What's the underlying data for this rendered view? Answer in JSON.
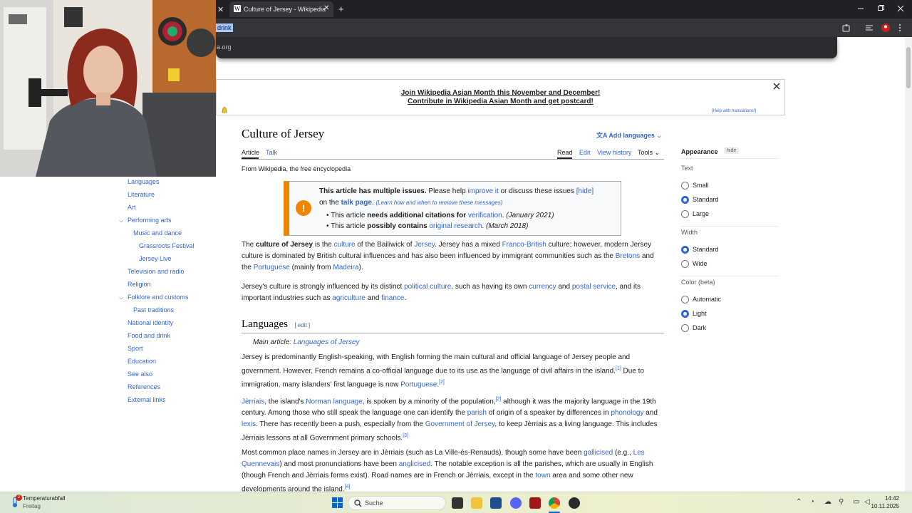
{
  "browser": {
    "tab_title": "Culture of Jersey - Wikipedia",
    "favicon": "W",
    "close_glyph": "✕",
    "new_tab_glyph": "+",
    "selected_text": "drink",
    "omnibox_suggestion": "a.org"
  },
  "banner": {
    "line1": "Join Wikipedia Asian Month this November and December!",
    "line2": "Contribute in Wikipedia Asian Month and get postcard!",
    "help": "[Help with translations!]"
  },
  "article": {
    "title": "Culture of Jersey",
    "add_languages": "Add languages",
    "tabs_left": [
      "Article",
      "Talk"
    ],
    "tabs_right": [
      "Read",
      "Edit",
      "View history",
      "Tools"
    ],
    "tagline": "From Wikipedia, the free encyclopedia"
  },
  "ambox": {
    "heading": "This article has multiple issues.",
    "line1_rest1": " Please help ",
    "improve_link": "improve it",
    "line1_rest2": " or discuss these issues ",
    "hide": "[hide]",
    "on_the": "on the ",
    "talk_page": "talk page",
    "learn": "(Learn how and when to remove these messages)",
    "issue1_a": "This article ",
    "issue1_b": "needs additional citations for",
    "issue1_link": "verification",
    "issue1_date": "(January 2021)",
    "issue2_a": "This article ",
    "issue2_b": "possibly contains",
    "issue2_link": "original research",
    "issue2_date": "(March 2018)"
  },
  "paragraphs": {
    "p1": {
      "t1": "The ",
      "b1": "culture of Jersey",
      "t2": " is the ",
      "l1": "culture",
      "t3": " of the Bailiwick of ",
      "l2": "Jersey",
      "t4": ". Jersey has a mixed ",
      "l3": "Franco-British",
      "t5": " culture; however, modern Jersey",
      "t6": "culture is dominated by British cultural influences and has also been influenced by immigrant communities such as the ",
      "l4": "Bretons",
      "t7": " and",
      "t8": "the ",
      "l5": "Portuguese",
      "t9": " (mainly from ",
      "l6": "Madeira",
      "t10": ")."
    },
    "p2": {
      "t1": "Jersey's culture is strongly influenced by its distinct ",
      "l1": "political culture",
      "t2": ", such as having its own ",
      "l2": "currency",
      "t3": " and ",
      "l3": "postal service",
      "t4": ", and its",
      "t5": "important industries such as ",
      "l4": "agriculture",
      "t6": " and ",
      "l5": "finance",
      "t7": "."
    },
    "h_languages": "Languages",
    "edit": "edit",
    "main_article_label": "Main article: ",
    "main_article_link": "Languages of Jersey",
    "p3": {
      "l1": "Jersey is predominantly English-speaking, with English forming the main cultural and official language of Jersey people and",
      "l2a": "government. However, French remains a co-official language due to its use as the language of civil affairs in the island.",
      "s1": "[1]",
      "l2b": " Due to",
      "l3a": "immigration, many islanders' first language is now ",
      "link": "Portuguese",
      "l3b": ".",
      "s2": "[2]"
    },
    "p4": {
      "link1": "Jèrriais",
      "t1": ", the island's ",
      "link2": "Norman language",
      "t2": ", is spoken by a minority of the population,",
      "s1": "[2]",
      "t3": " although it was the majority language in the 19th",
      "t4": "century. Among those who still speak the language one can identify the ",
      "link3": "parish",
      "t5": " of origin of a speaker by differences in ",
      "link4": "phonology",
      "t6": " and",
      "link5": "lexis",
      "t7": ". There has recently been a push, especially from the ",
      "link6": "Government of Jersey",
      "t8": ", to keep Jèrriais as a living language. This includes",
      "t9": "Jèrriais lessons at all Government primary schools.",
      "s2": "[3]"
    },
    "p5": {
      "t1": "Most common place names in Jersey are in Jèrriais (such as La Ville-ès-Renauds), though some have been ",
      "link1": "gallicised",
      "t2": " (e.g., ",
      "link2": "Les",
      "link2b": "Quennevais",
      "t3": ") and most pronunciations have been ",
      "link3": "anglicised",
      "t4": ". The notable exception is all the parishes, which are usually in English",
      "t5": "(though French and Jèrriais forms exist). Road names are in French or Jèrriais, except in the ",
      "link4": "town",
      "t6": " area and some other new",
      "t7": "developments around the island.",
      "s1": "[4]"
    }
  },
  "toc": [
    {
      "label": "Languages",
      "indent": 0,
      "caret": false
    },
    {
      "label": "Literature",
      "indent": 0,
      "caret": false
    },
    {
      "label": "Art",
      "indent": 0,
      "caret": false
    },
    {
      "label": "Performing arts",
      "indent": 0,
      "caret": true
    },
    {
      "label": "Music and dance",
      "indent": 1,
      "caret": false
    },
    {
      "label": "Grassroots Festival",
      "indent": 2,
      "caret": false
    },
    {
      "label": "Jersey Live",
      "indent": 2,
      "caret": false
    },
    {
      "label": "Television and radio",
      "indent": 0,
      "caret": false
    },
    {
      "label": "Religion",
      "indent": 0,
      "caret": false
    },
    {
      "label": "Folklore and customs",
      "indent": 0,
      "caret": true
    },
    {
      "label": "Past traditions",
      "indent": 1,
      "caret": false
    },
    {
      "label": "National identity",
      "indent": 0,
      "caret": false
    },
    {
      "label": "Food and drink",
      "indent": 0,
      "caret": false
    },
    {
      "label": "Sport",
      "indent": 0,
      "caret": false
    },
    {
      "label": "Education",
      "indent": 0,
      "caret": false
    },
    {
      "label": "See also",
      "indent": 0,
      "caret": false
    },
    {
      "label": "References",
      "indent": 0,
      "caret": false
    },
    {
      "label": "External links",
      "indent": 0,
      "caret": false
    }
  ],
  "appearance": {
    "title": "Appearance",
    "hide": "hide",
    "text_label": "Text",
    "text_options": [
      "Small",
      "Standard",
      "Large"
    ],
    "text_selected": 1,
    "width_label": "Width",
    "width_options": [
      "Standard",
      "Wide"
    ],
    "width_selected": 0,
    "color_label": "Color (beta)",
    "color_options": [
      "Automatic",
      "Light",
      "Dark"
    ],
    "color_selected": 1
  },
  "taskbar": {
    "weather_badge": "2",
    "weather_title": "Temperaturabfall",
    "weather_sub": "Freitag",
    "search": "Suche",
    "time": "14:42",
    "date": "10.11.2025"
  }
}
